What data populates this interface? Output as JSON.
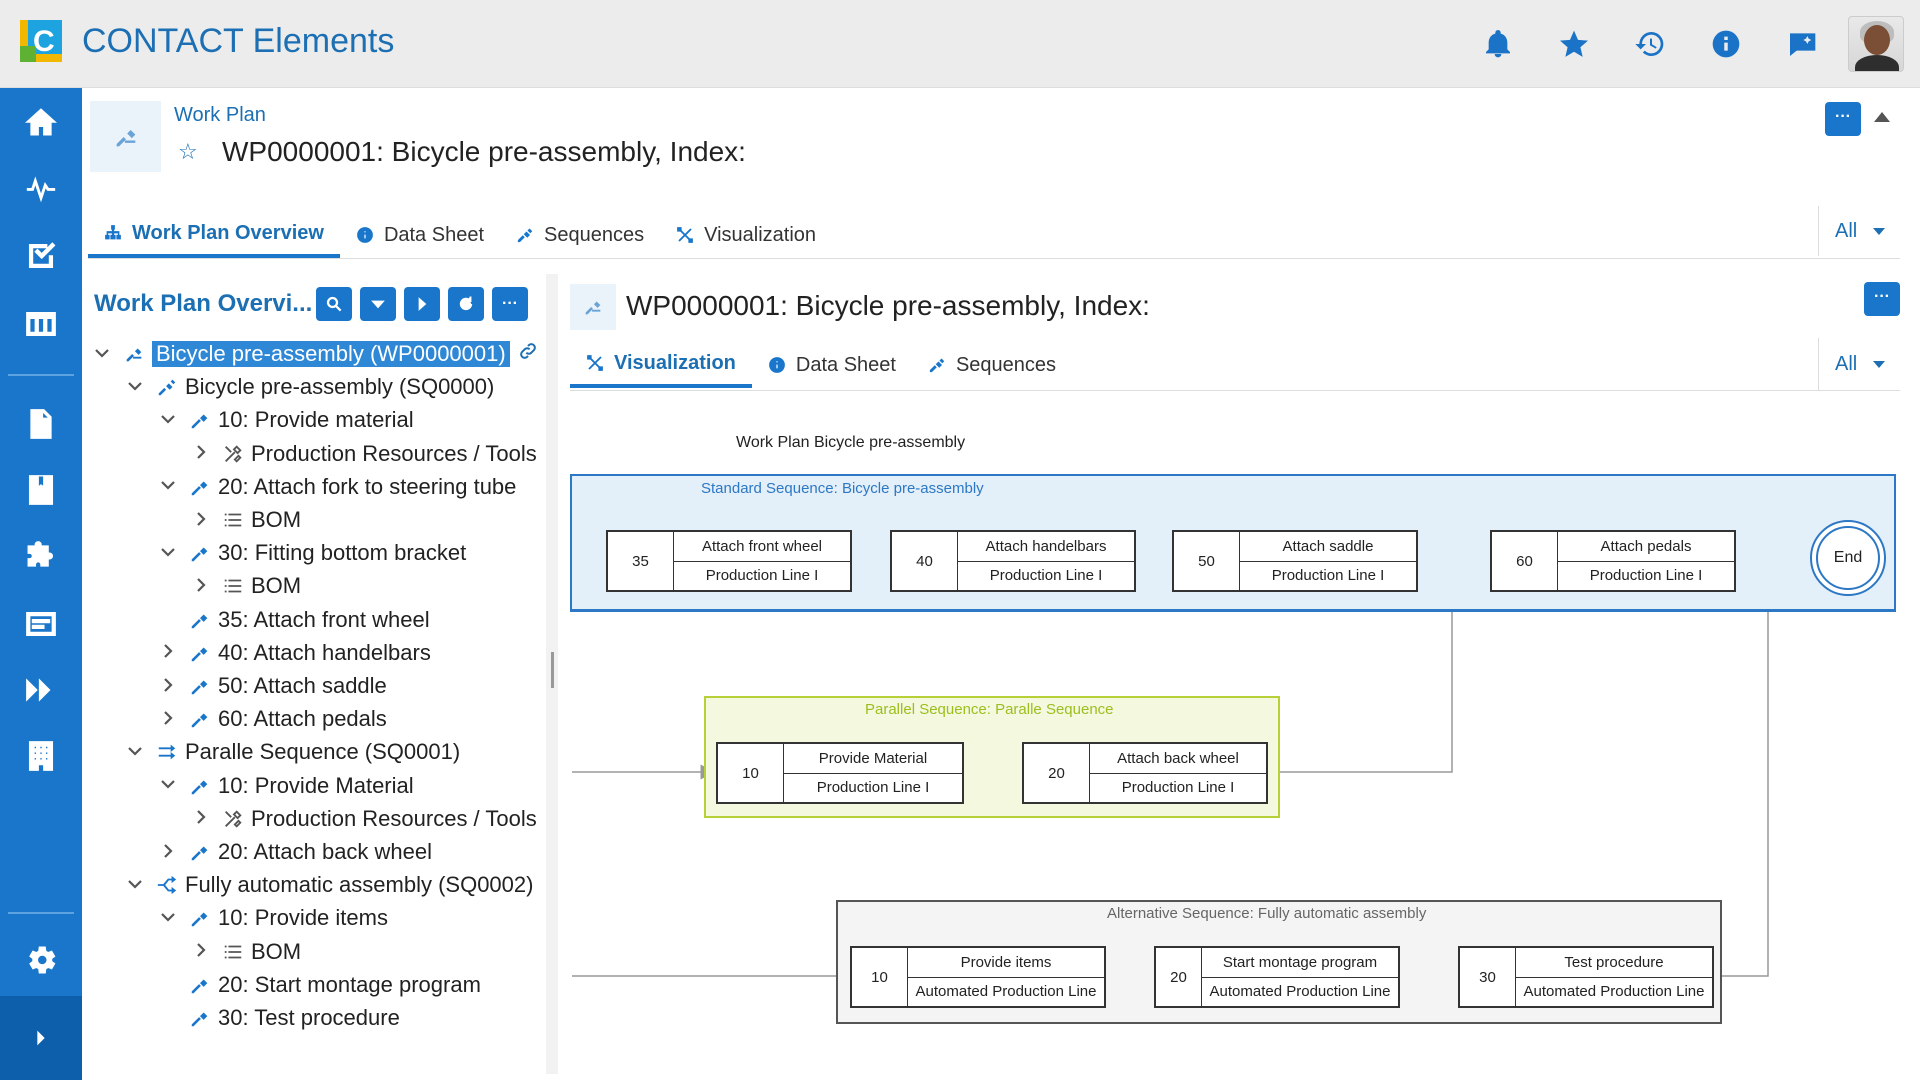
{
  "app": {
    "title": "CONTACT Elements",
    "logo_letter": "C"
  },
  "topbar_icons": [
    "bell-icon",
    "star-icon",
    "history-icon",
    "info-icon",
    "feedback-icon"
  ],
  "leftnav": [
    "home-icon",
    "activity-icon",
    "tasks-icon",
    "table-icon",
    "document-icon",
    "folder-icon",
    "puzzle-icon",
    "card-icon",
    "forward-icon",
    "building-icon",
    "settings-icon"
  ],
  "header": {
    "breadcrumb": "Work Plan",
    "title": "WP0000001: Bicycle pre-assembly, Index:",
    "more_label": "···"
  },
  "tabs": [
    {
      "label": "Work Plan Overview",
      "icon": "hierarchy-icon",
      "active": true
    },
    {
      "label": "Data Sheet",
      "icon": "info-icon",
      "active": false
    },
    {
      "label": "Sequences",
      "icon": "sequence-icon",
      "active": false
    },
    {
      "label": "Visualization",
      "icon": "visualization-icon",
      "active": false
    }
  ],
  "filter_all": "All",
  "tree_panel": {
    "header": "Work Plan Overvi...",
    "more_label": "···",
    "rows": [
      {
        "label": "Bicycle pre-assembly (WP0000001)",
        "level": 0,
        "toggle": "open",
        "icon": "plan",
        "selected": true
      },
      {
        "label": "Bicycle pre-assembly (SQ0000)",
        "level": 1,
        "toggle": "open",
        "icon": "sequence"
      },
      {
        "label": "10: Provide material",
        "level": 2,
        "toggle": "open",
        "icon": "operation"
      },
      {
        "label": "Production Resources / Tools",
        "level": 3,
        "toggle": "closed",
        "icon": "tools"
      },
      {
        "label": "20: Attach fork to steering tube",
        "level": 2,
        "toggle": "open",
        "icon": "operation"
      },
      {
        "label": "BOM",
        "level": 3,
        "toggle": "closed",
        "icon": "list"
      },
      {
        "label": "30: Fitting bottom bracket",
        "level": 2,
        "toggle": "open",
        "icon": "operation"
      },
      {
        "label": "BOM",
        "level": 3,
        "toggle": "closed",
        "icon": "list"
      },
      {
        "label": "35: Attach front wheel",
        "level": 2,
        "toggle": "none",
        "icon": "operation"
      },
      {
        "label": "40: Attach handelbars",
        "level": 2,
        "toggle": "closed",
        "icon": "operation"
      },
      {
        "label": "50: Attach saddle",
        "level": 2,
        "toggle": "closed",
        "icon": "operation"
      },
      {
        "label": "60: Attach pedals",
        "level": 2,
        "toggle": "closed",
        "icon": "operation"
      },
      {
        "label": "Paralle Sequence (SQ0001)",
        "level": 1,
        "toggle": "open",
        "icon": "parallel"
      },
      {
        "label": "10: Provide Material",
        "level": 2,
        "toggle": "open",
        "icon": "operation"
      },
      {
        "label": "Production Resources / Tools",
        "level": 3,
        "toggle": "closed",
        "icon": "tools"
      },
      {
        "label": "20: Attach back wheel",
        "level": 2,
        "toggle": "closed",
        "icon": "operation"
      },
      {
        "label": "Fully automatic assembly (SQ0002)",
        "level": 1,
        "toggle": "open",
        "icon": "alternative"
      },
      {
        "label": "10: Provide items",
        "level": 2,
        "toggle": "open",
        "icon": "operation"
      },
      {
        "label": "BOM",
        "level": 3,
        "toggle": "closed",
        "icon": "list"
      },
      {
        "label": "20: Start montage program",
        "level": 2,
        "toggle": "none",
        "icon": "operation"
      },
      {
        "label": "30: Test procedure",
        "level": 2,
        "toggle": "none",
        "icon": "operation"
      }
    ]
  },
  "right_panel": {
    "title": "WP0000001: Bicycle pre-assembly, Index:",
    "more_label": "···",
    "tabs": [
      {
        "label": "Visualization",
        "icon": "visualization-icon",
        "active": true
      },
      {
        "label": "Data Sheet",
        "icon": "info-icon",
        "active": false
      },
      {
        "label": "Sequences",
        "icon": "sequence-icon",
        "active": false
      }
    ],
    "filter_all": "All"
  },
  "diagram": {
    "title": "Work Plan Bicycle pre-assembly",
    "standard": {
      "label": "Standard Sequence: Bicycle pre-assembly",
      "color": "#2d78c4",
      "ops": [
        {
          "num": "35",
          "name": "Attach front wheel",
          "line": "Production Line I"
        },
        {
          "num": "40",
          "name": "Attach handelbars",
          "line": "Production Line I"
        },
        {
          "num": "50",
          "name": "Attach saddle",
          "line": "Production Line I"
        },
        {
          "num": "60",
          "name": "Attach pedals",
          "line": "Production Line I"
        }
      ],
      "end": "End"
    },
    "parallel": {
      "label": "Parallel Sequence: Paralle Sequence",
      "color": "#9cbf1e",
      "ops": [
        {
          "num": "10",
          "name": "Provide Material",
          "line": "Production Line I"
        },
        {
          "num": "20",
          "name": "Attach back wheel",
          "line": "Production Line I"
        }
      ]
    },
    "alternative": {
      "label": "Alternative Sequence: Fully automatic assembly",
      "color": "#555555",
      "ops": [
        {
          "num": "10",
          "name": "Provide items",
          "line": "Automated Production Line"
        },
        {
          "num": "20",
          "name": "Start montage program",
          "line": "Automated Production Line"
        },
        {
          "num": "30",
          "name": "Test procedure",
          "line": "Automated Production Line"
        }
      ]
    }
  }
}
